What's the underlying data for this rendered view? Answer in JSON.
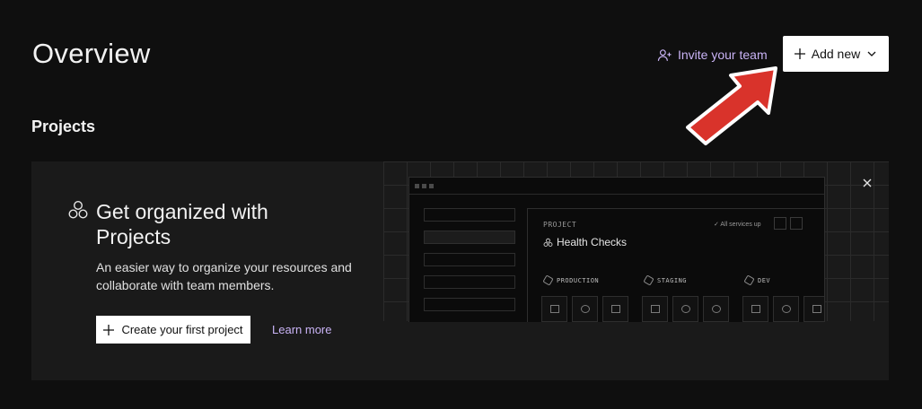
{
  "header": {
    "title": "Overview",
    "invite_label": "Invite your team",
    "add_new_label": "Add new"
  },
  "projects": {
    "section_title": "Projects",
    "promo": {
      "title": "Get organized with Projects",
      "description": "An easier way to organize your resources and collaborate with team members.",
      "create_button": "Create your first project",
      "learn_more": "Learn more"
    },
    "preview": {
      "label": "PROJECT",
      "status": "✓ All services up",
      "project_name": "Health Checks",
      "environments": [
        "PRODUCTION",
        "STAGING",
        "DEV"
      ]
    }
  },
  "colors": {
    "background": "#0f0f0f",
    "card": "#1a1a1a",
    "accent_link": "#c9b3f5",
    "annotation_arrow": "#d9332b"
  },
  "icons": {
    "invite": "user-plus-icon",
    "add": "plus-icon",
    "dropdown": "chevron-down-icon",
    "projects": "three-circles-icon",
    "close": "close-icon"
  }
}
